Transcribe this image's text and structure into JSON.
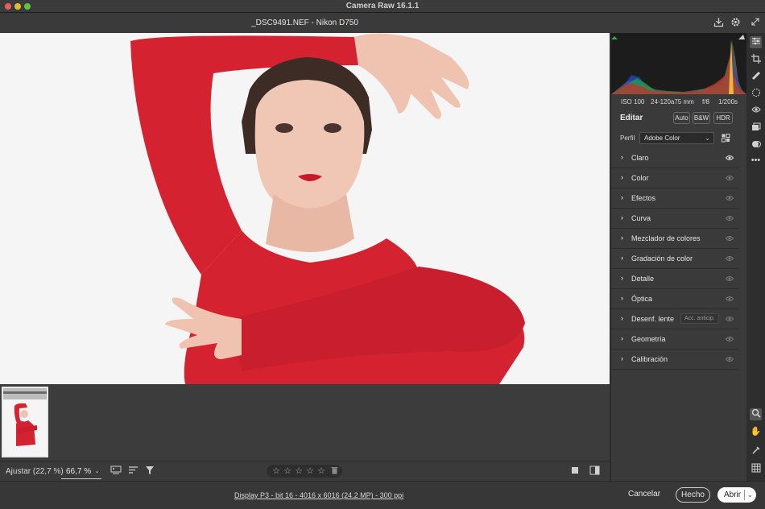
{
  "window": {
    "title": "Camera Raw 16.1.1"
  },
  "header": {
    "file_info": "_DSC9491.NEF -  Nikon D750"
  },
  "histogram_meta": {
    "iso": "ISO 100",
    "lens": "24-120a75 mm",
    "aperture": "f/8",
    "shutter": "1/200s"
  },
  "edit": {
    "title": "Editar",
    "auto_label": "Auto",
    "bw_label": "B&W",
    "hdr_label": "HDR",
    "profile_label": "Perfil",
    "profile_value": "Adobe Color"
  },
  "sections": [
    {
      "label": "Claro"
    },
    {
      "label": "Color"
    },
    {
      "label": "Efectos"
    },
    {
      "label": "Curva"
    },
    {
      "label": "Mezclador de colores"
    },
    {
      "label": "Gradación de color"
    },
    {
      "label": "Detalle"
    },
    {
      "label": "Óptica"
    },
    {
      "label": "Desenf. lente",
      "tag": "Acc. anticip."
    },
    {
      "label": "Geometría"
    },
    {
      "label": "Calibración"
    }
  ],
  "toolbar": {
    "fit_label": "Ajustar (22,7 %)",
    "zoom_value": "66,7 %"
  },
  "rating": {
    "stars": 0,
    "max": 5
  },
  "status": {
    "workflow": "Display P3 - bit 16 - 4016 x 6016 (24.2 MP) - 300 ppi",
    "cancel": "Cancelar",
    "done": "Hecho",
    "open": "Abrir"
  },
  "colors": {
    "background": "#2b2b2b",
    "panel": "#3a3a3a",
    "dress": "#d6232f",
    "backdrop": "#f4f4f4"
  },
  "icons": [
    "save-icon",
    "gear-icon",
    "fullscreen-icon",
    "edit-sliders-icon",
    "crop-icon",
    "heal-icon",
    "mask-icon",
    "red-eye-icon",
    "snapshots-icon",
    "presets-icon",
    "more-icon",
    "zoom-icon",
    "hand-icon",
    "color-sampler-icon",
    "grid-icon"
  ]
}
